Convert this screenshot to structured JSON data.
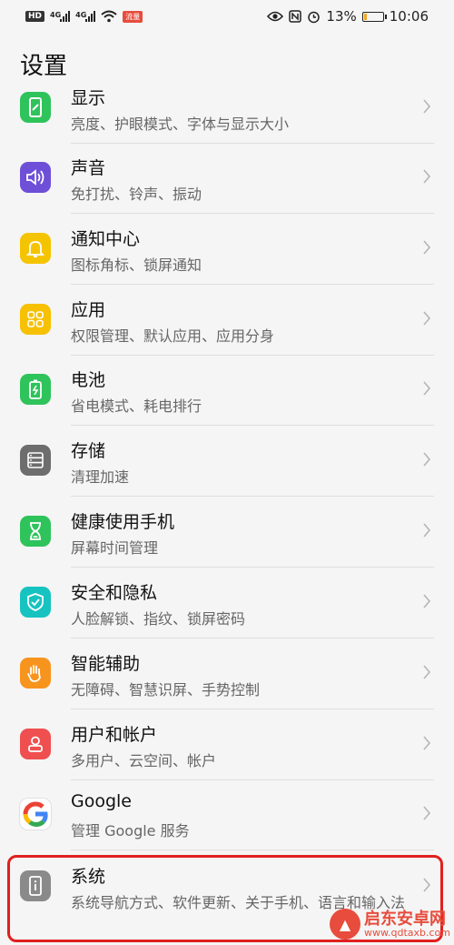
{
  "status_bar": {
    "hd": "HD",
    "net1": "4G",
    "net2": "4G",
    "badge": "流量",
    "battery_percent": "13%",
    "time": "10:06",
    "battery_level": 0.13
  },
  "page": {
    "title": "设置"
  },
  "items": [
    {
      "title": "显示",
      "subtitle": "亮度、护眼模式、字体与显示大小",
      "icon": "display-icon",
      "color": "#2fc35b"
    },
    {
      "title": "声音",
      "subtitle": "免打扰、铃声、振动",
      "icon": "sound-icon",
      "color": "#6e4fd8"
    },
    {
      "title": "通知中心",
      "subtitle": "图标角标、锁屏通知",
      "icon": "bell-icon",
      "color": "#f5c400"
    },
    {
      "title": "应用",
      "subtitle": "权限管理、默认应用、应用分身",
      "icon": "apps-icon",
      "color": "#f7c000"
    },
    {
      "title": "电池",
      "subtitle": "省电模式、耗电排行",
      "icon": "battery-icon",
      "color": "#2fc35b"
    },
    {
      "title": "存储",
      "subtitle": "清理加速",
      "icon": "storage-icon",
      "color": "#6d6d6d"
    },
    {
      "title": "健康使用手机",
      "subtitle": "屏幕时间管理",
      "icon": "hourglass-icon",
      "color": "#2fc35b"
    },
    {
      "title": "安全和隐私",
      "subtitle": "人脸解锁、指纹、锁屏密码",
      "icon": "shield-icon",
      "color": "#16c3c1"
    },
    {
      "title": "智能辅助",
      "subtitle": "无障碍、智慧识屏、手势控制",
      "icon": "hand-icon",
      "color": "#f7941d"
    },
    {
      "title": "用户和帐户",
      "subtitle": "多用户、云空间、帐户",
      "icon": "user-icon",
      "color": "#ef4f4f"
    },
    {
      "title": "Google",
      "subtitle": "管理 Google 服务",
      "icon": "google-icon",
      "color": "#ffffff"
    },
    {
      "title": "系统",
      "subtitle": "系统导航方式、软件更新、关于手机、语言和输入法",
      "icon": "system-info-icon",
      "color": "#8a8a8a"
    }
  ],
  "watermark": {
    "name": "启东安卓网",
    "url": "www.qdtaxb.com"
  }
}
